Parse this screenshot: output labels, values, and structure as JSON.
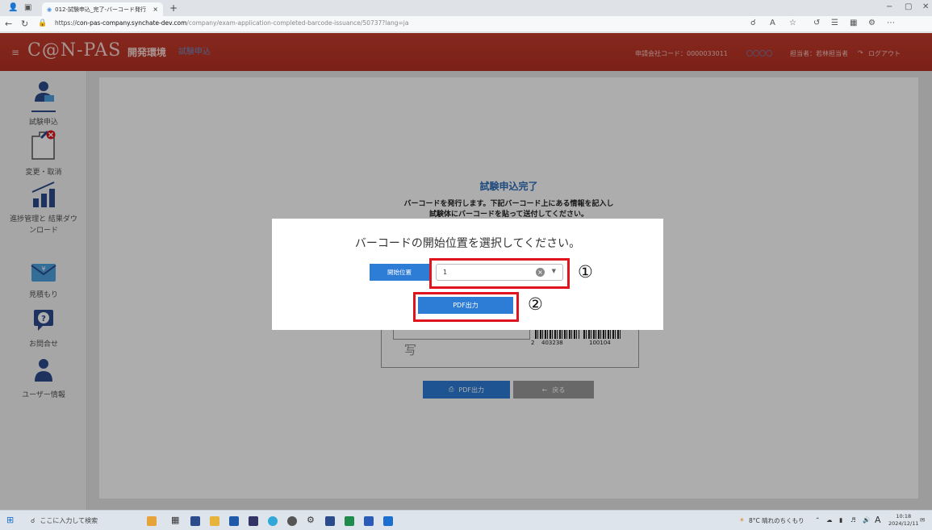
{
  "browser": {
    "tab_title": "012-試験申込_完了-バーコード発行",
    "tab_close": "×",
    "new_tab": "+",
    "url_scheme": "https://",
    "url_host": "con-pas-company.synchate-dev.com",
    "url_path": "/company/exam-application-completed-barcode-issuance/50737?lang=ja",
    "window_min": "−",
    "window_max": "▢",
    "window_close": "✕"
  },
  "header": {
    "logo": "C@N-PAS",
    "env_label": "開発環境",
    "badge": "試験申込",
    "company_code_label": "申請会社コード：0000033011",
    "status": "〇〇〇〇",
    "person": "担当者：若林担当者",
    "logout": "ログアウト"
  },
  "sidebar": {
    "items": [
      {
        "label": "試験申込"
      },
      {
        "label": "変更・取消"
      },
      {
        "label": "進捗管理と 結果ダウンロード"
      },
      {
        "label": "見積もり"
      },
      {
        "label": "お問合せ"
      },
      {
        "label": "ユーザー情報"
      }
    ]
  },
  "main": {
    "title": "試験申込完了",
    "message_line1": "バーコードを発行します。下記バーコード上にある情報を記入し",
    "message_line2": "試験体にバーコードを貼って送付してください。",
    "preview_kanji": "写",
    "barcode_prefix": "2",
    "barcode_num1": "403238",
    "barcode_num2": "100104",
    "pdf_button": "PDF出力",
    "back_button": "戻る"
  },
  "modal": {
    "title": "バーコードの開始位置を選択してください。",
    "start_label": "開始位置",
    "start_value": "1",
    "pdf_button": "PDF出力"
  },
  "annotations": {
    "one": "①",
    "two": "②"
  },
  "taskbar": {
    "search_placeholder": "ここに入力して検索",
    "weather": "8°C 晴れのちくもり",
    "ime": "A",
    "time": "10:18",
    "date": "2024/12/11"
  },
  "colors": {
    "header_red": "#c0392b",
    "primary_blue": "#2d7cd6",
    "annotation_red": "#e0141e",
    "title_blue": "#2f6fbb"
  }
}
